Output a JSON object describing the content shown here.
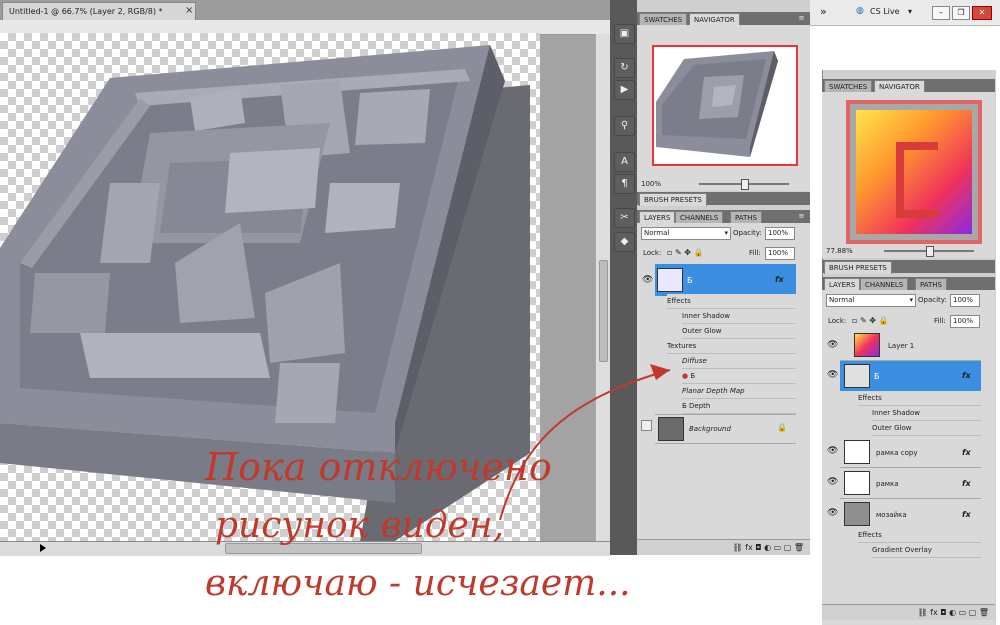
{
  "document": {
    "tab_title": "Untitled-1 @ 66.7% (Layer 2, RGB/8) *",
    "tab_close": "×"
  },
  "app_bar": {
    "arrows": "»",
    "cs_live": "CS Live",
    "cs_live_arrow": "▾"
  },
  "navigator_panel_1": {
    "tabs": [
      "SWATCHES",
      "NAVIGATOR"
    ],
    "zoom": "100%",
    "brush_presets": "BRUSH PRESETS"
  },
  "layers_panel_1": {
    "tabs": [
      "LAYERS",
      "CHANNELS",
      "PATHS"
    ],
    "blend_mode": "Normal",
    "opacity_label": "Opacity:",
    "opacity_value": "100%",
    "lock_label": "Lock:",
    "fill_label": "Fill:",
    "fill_value": "100%",
    "layer_b": "Б",
    "effects": "Effects",
    "inner_shadow": "Inner Shadow",
    "outer_glow": "Outer Glow",
    "textures": "Textures",
    "diffuse": "Diffuse",
    "diffuse_item": "Б",
    "planar_depth": "Planar Depth Map",
    "depth_item": "Б Depth",
    "background": "Background",
    "fx": "fx"
  },
  "navigator_panel_2": {
    "tabs": [
      "SWATCHES",
      "NAVIGATOR"
    ],
    "zoom": "77.88%",
    "brush_presets": "BRUSH PRESETS"
  },
  "layers_panel_2": {
    "tabs": [
      "LAYERS",
      "CHANNELS",
      "PATHS"
    ],
    "blend_mode": "Normal",
    "opacity_label": "Opacity:",
    "opacity_value": "100%",
    "lock_label": "Lock:",
    "fill_label": "Fill:",
    "fill_value": "100%",
    "layer1": "Layer 1",
    "layer_b": "Б",
    "effects": "Effects",
    "inner_shadow": "Inner Shadow",
    "outer_glow": "Outer Glow",
    "ramka_copy": "рамка copy",
    "ramka": "рамка",
    "mozaika": "мозайка",
    "effects2": "Effects",
    "gradient_overlay": "Gradient Overlay",
    "fx": "fx"
  },
  "handwriting": {
    "line1": "Пока отключено",
    "line2": "рисунок виден,",
    "line3": "включаю - исчезает..."
  },
  "colors": {
    "accent_blue": "#3c8fe0",
    "handwriting_red": "#c0392b"
  }
}
